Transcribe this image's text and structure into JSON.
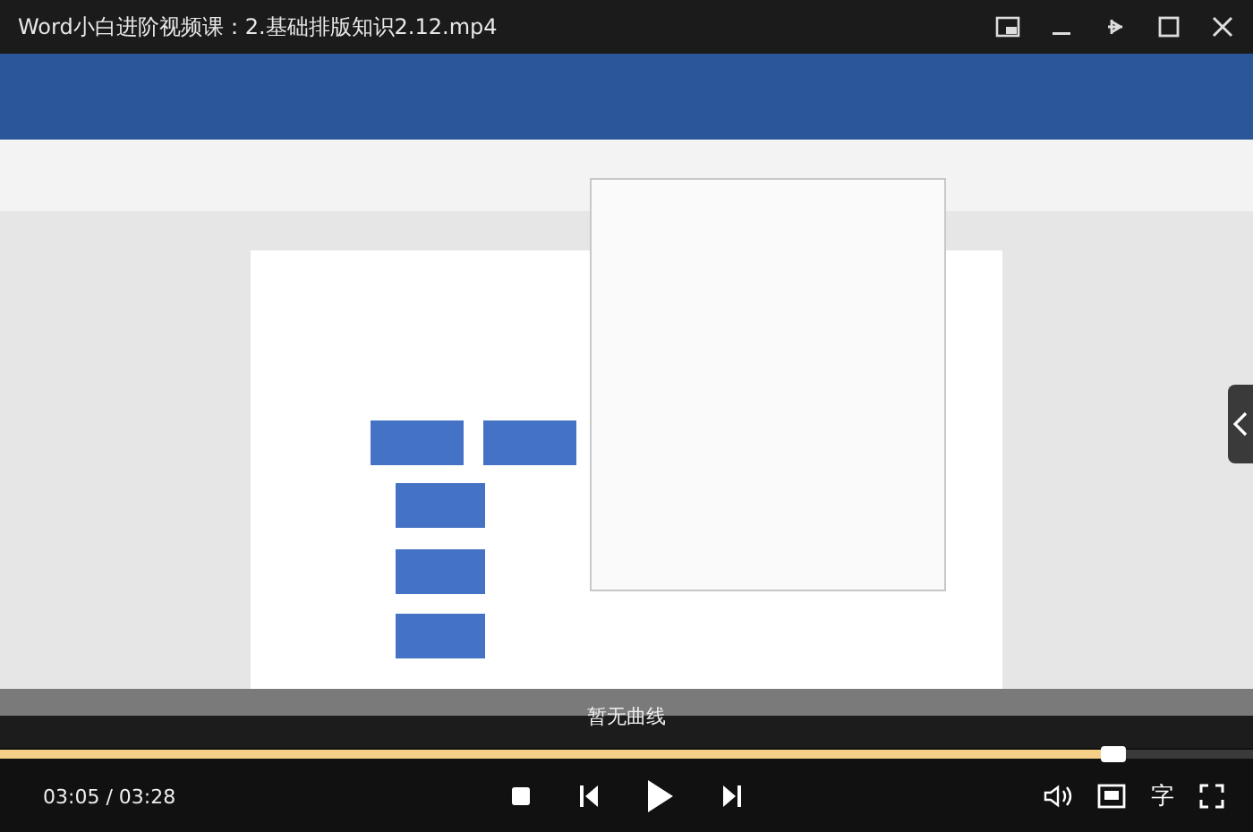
{
  "window": {
    "title": "Word小白进阶视频课：2.基础排版知识2.12.mp4"
  },
  "overlay": {
    "text": "暂无曲线"
  },
  "progress": {
    "level": 0.889
  },
  "controls": {
    "time": "03:05 / 03:28",
    "subtitle_button": "字"
  }
}
